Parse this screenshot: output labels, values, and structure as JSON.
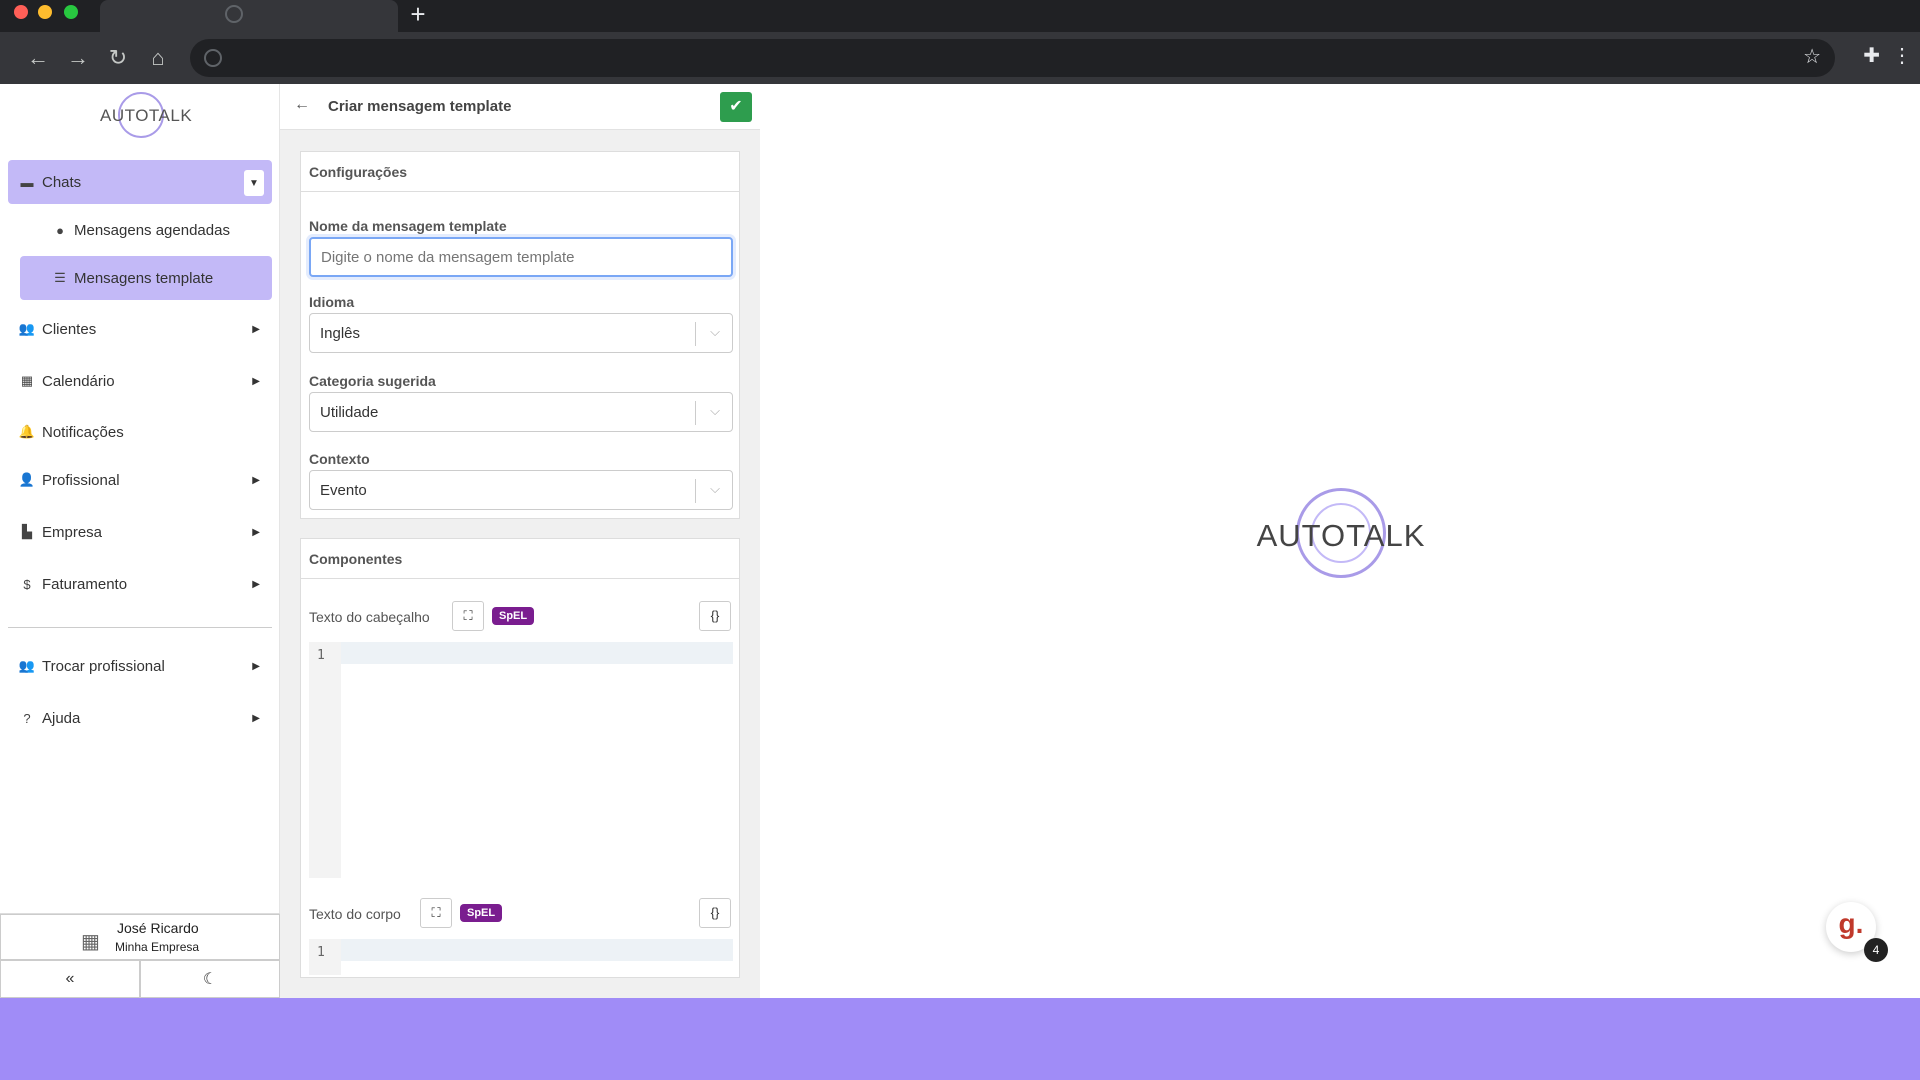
{
  "sidebar": {
    "logo": "AUTOTALK",
    "items": [
      {
        "label": "Chats",
        "icon": "comment-icon"
      },
      {
        "label": "Mensagens agendadas",
        "icon": "clock-icon"
      },
      {
        "label": "Mensagens template",
        "icon": "list-icon"
      },
      {
        "label": "Clientes",
        "icon": "users-icon"
      },
      {
        "label": "Calendário",
        "icon": "calendar-icon"
      },
      {
        "label": "Notificações",
        "icon": "bell-icon"
      },
      {
        "label": "Profissional",
        "icon": "user-tie-icon"
      },
      {
        "label": "Empresa",
        "icon": "building-icon"
      },
      {
        "label": "Faturamento",
        "icon": "dollar-icon"
      },
      {
        "label": "Trocar profissional",
        "icon": "users-swap-icon"
      },
      {
        "label": "Ajuda",
        "icon": "question-icon"
      }
    ],
    "user": {
      "name": "José Ricardo",
      "company": "Minha Empresa"
    }
  },
  "form": {
    "title": "Criar mensagem template",
    "config_title": "Configurações",
    "name_label": "Nome da mensagem template",
    "name_placeholder": "Digite o nome da mensagem template",
    "language_label": "Idioma",
    "language_value": "Inglês",
    "category_label": "Categoria sugerida",
    "category_value": "Utilidade",
    "context_label": "Contexto",
    "context_value": "Evento",
    "components_title": "Componentes",
    "header_text_label": "Texto do cabeçalho",
    "body_text_label": "Texto do corpo",
    "spel_badge": "SpEL",
    "line_number": "1"
  },
  "main": {
    "logo": "AUTOTALK",
    "help_badge_count": "4",
    "help_icon_text": "g."
  },
  "colors": {
    "accent": "#c3b9f7",
    "save": "#2e9d4e",
    "spel": "#7a1d8f",
    "band": "#a08cf7"
  }
}
